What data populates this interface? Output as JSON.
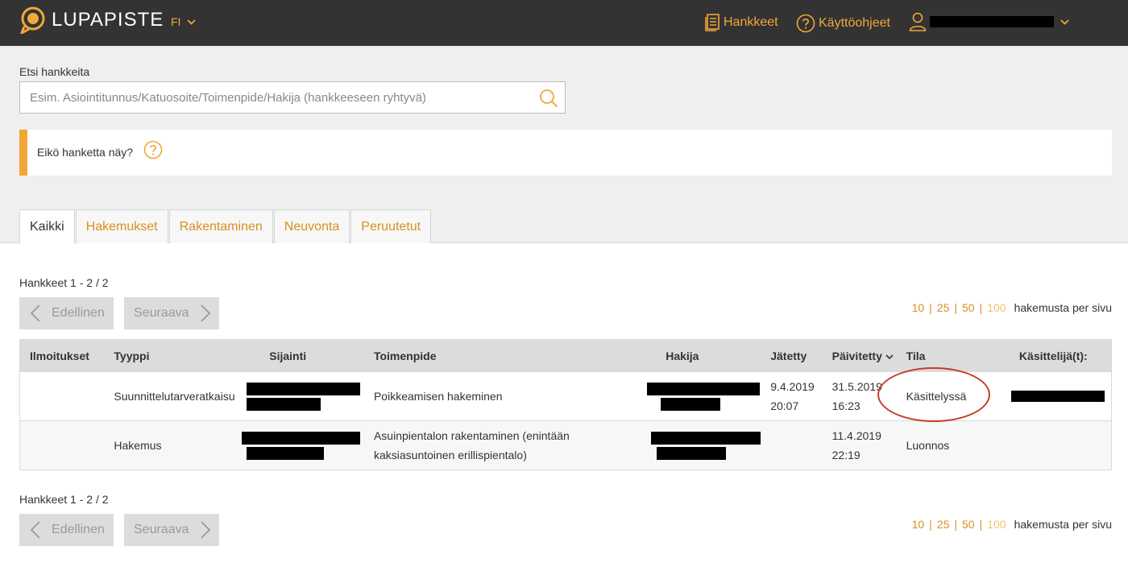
{
  "header": {
    "logo_text": "LUPAPISTE",
    "language": "FI",
    "nav": {
      "projects": "Hankkeet",
      "help": "Käyttöohjeet"
    }
  },
  "search": {
    "label": "Etsi hankkeita",
    "placeholder": "Esim. Asiointitunnus/Katuosoite/Toimenpide/Hakija (hankkeeseen ryhtyvä)"
  },
  "notice": {
    "text": "Eikö hanketta näy?"
  },
  "tabs": [
    "Kaikki",
    "Hakemukset",
    "Rakentaminen",
    "Neuvonta",
    "Peruutetut"
  ],
  "pager": {
    "count": "Hankkeet 1 - 2 / 2",
    "prev": "Edellinen",
    "next": "Seuraava",
    "per_page_options": [
      "10",
      "25",
      "50",
      "100"
    ],
    "per_page_label": "hakemusta per sivu"
  },
  "table": {
    "headers": [
      "Ilmoitukset",
      "Tyyppi",
      "Sijainti",
      "Toimenpide",
      "Hakija",
      "Jätetty",
      "Päivitetty",
      "Tila",
      "Käsittelijä(t):"
    ],
    "rows": [
      {
        "type": "Suunnittelutarveratkaisu",
        "operation": "Poikkeamisen hakeminen",
        "submitted_date": "9.4.2019",
        "submitted_time": "20:07",
        "updated_date": "31.5.2019",
        "updated_time": "16:23",
        "state": "Käsittelyssä"
      },
      {
        "type": "Hakemus",
        "operation": "Asuinpientalon rakentaminen (enintään kaksiasuntoinen erillispientalo)",
        "submitted_date": "",
        "submitted_time": "",
        "updated_date": "11.4.2019",
        "updated_time": "22:19",
        "state": "Luonnos"
      }
    ]
  },
  "colors": {
    "accent": "#f0a838",
    "topbar": "#333333",
    "annotation": "#c83a2a"
  }
}
